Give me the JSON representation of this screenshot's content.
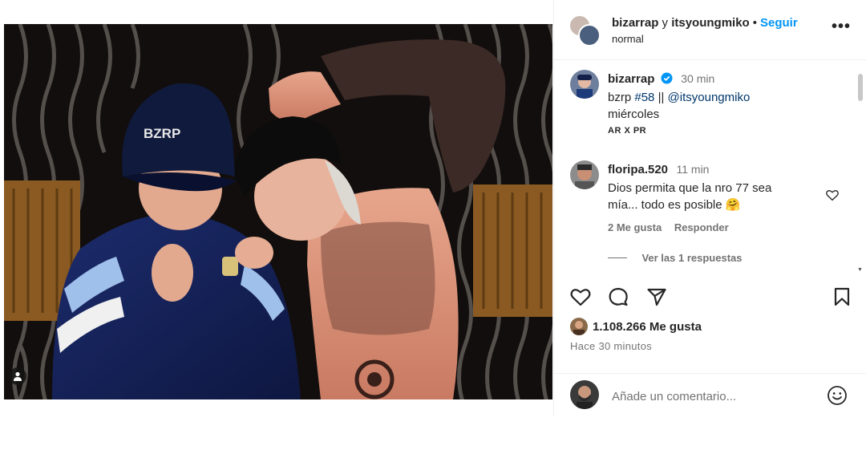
{
  "post_header": {
    "author_1": "bizarrap",
    "conjunction": "y",
    "author_2": "itsyoungmiko",
    "separator": "•",
    "follow_label": "Seguir",
    "audio_label": "normal",
    "more_label": "•••"
  },
  "caption": {
    "username": "bizarrap",
    "time": "30 min",
    "text_prefix": "bzrp",
    "hashtag": "#58",
    "divider": "||",
    "mention": "@itsyoungmiko",
    "line2": "miércoles",
    "line3": "AR X PR"
  },
  "comment": {
    "username": "floripa.520",
    "time": "11 min",
    "text_line1": "Dios permita que la nro 77 sea",
    "text_line2": "mía... todo es posible",
    "emoji": "🤗",
    "likes_label": "2 Me gusta",
    "reply_label": "Responder",
    "view_replies_label": "Ver las 1 respuestas"
  },
  "actions": {
    "like_icon": "heart-icon",
    "comment_icon": "comment-icon",
    "share_icon": "share-icon",
    "save_icon": "bookmark-icon"
  },
  "likes_text": "1.108.266 Me gusta",
  "timestamp": "Hace 30 minutos",
  "add_comment": {
    "placeholder": "Añade un comentario...",
    "emoji_icon": "smiley-icon"
  },
  "photo": {
    "cap_text": "BZRP",
    "tag_icon": "user-tag-icon"
  },
  "colors": {
    "follow_blue": "#0095f6",
    "verified_blue": "#0095f6",
    "link_blue": "#00376b",
    "muted_gray": "#737373"
  }
}
